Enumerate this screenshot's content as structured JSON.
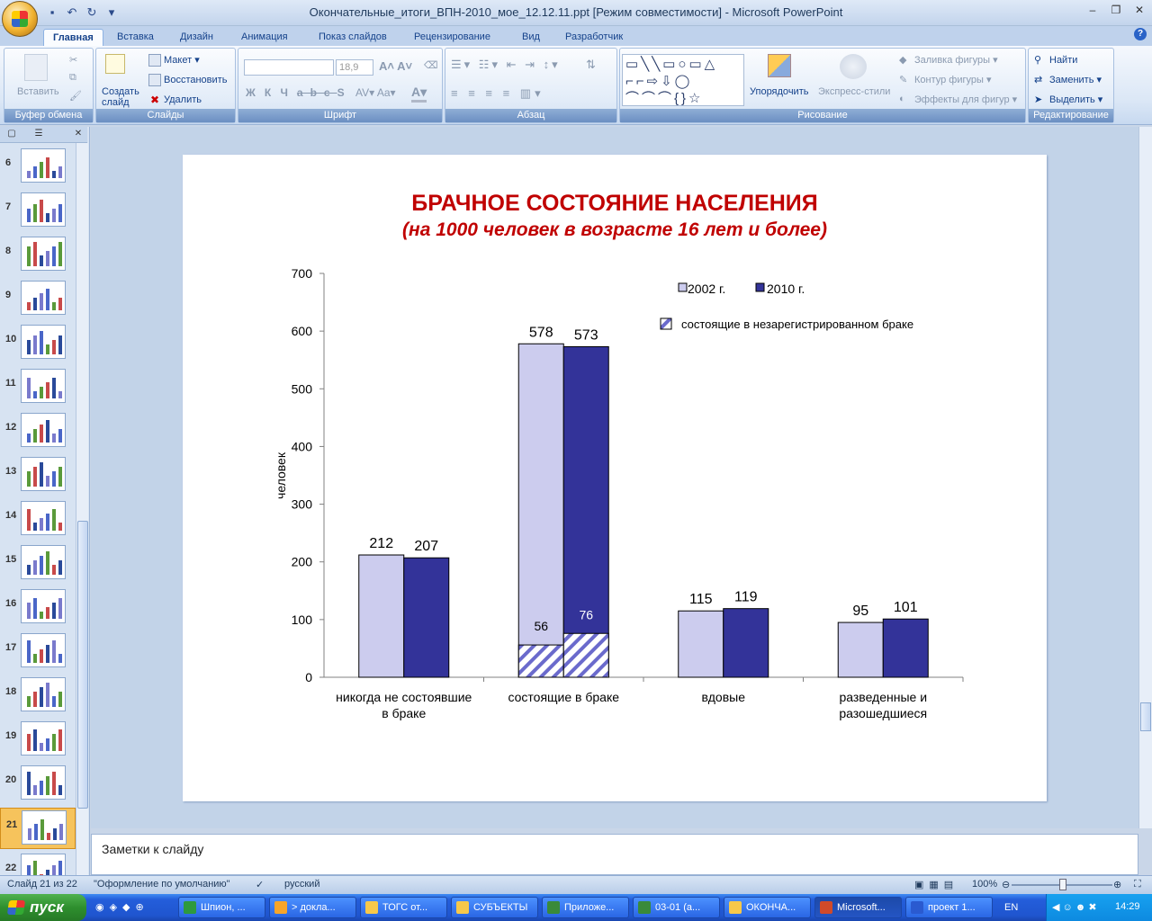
{
  "window": {
    "title": "Окончательные_итоги_ВПН-2010_мое_12.12.11.ppt [Режим совместимости] - Microsoft PowerPoint"
  },
  "ribbon": {
    "tabs": [
      "Главная",
      "Вставка",
      "Дизайн",
      "Анимация",
      "Показ слайдов",
      "Рецензирование",
      "Вид",
      "Разработчик"
    ],
    "active_tab": "Главная",
    "groups": {
      "clipboard": {
        "label": "Буфер обмена",
        "paste": "Вставить"
      },
      "slides": {
        "label": "Слайды",
        "create": "Создать слайд",
        "layout": "Макет",
        "reset": "Восстановить",
        "delete": "Удалить"
      },
      "font": {
        "label": "Шрифт",
        "font_size": "18,9"
      },
      "paragraph": {
        "label": "Абзац"
      },
      "drawing": {
        "label": "Рисование",
        "arrange": "Упорядочить",
        "quick_styles": "Экспресс-стили",
        "fill": "Заливка фигуры",
        "outline": "Контур фигуры",
        "effects": "Эффекты для фигур"
      },
      "editing": {
        "label": "Редактирование",
        "find": "Найти",
        "replace": "Заменить",
        "select": "Выделить"
      }
    }
  },
  "slide_panel": {
    "numbers": [
      "6",
      "7",
      "8",
      "9",
      "10",
      "11",
      "12",
      "13",
      "14",
      "15",
      "16",
      "17",
      "18",
      "19",
      "20",
      "21",
      "22"
    ],
    "selected": "21"
  },
  "notes": {
    "placeholder": "Заметки к слайду"
  },
  "status": {
    "slide_info": "Слайд 21 из 22",
    "theme": "\"Оформление по умолчанию\"",
    "language": "русский",
    "zoom": "100%"
  },
  "taskbar": {
    "start": "пуск",
    "tasks": [
      "Шпион, ...",
      "> доклa...",
      "ТОГС от...",
      "СУБЪЕКТЫ",
      "Приложе...",
      "03-01 (а...",
      "ОКОНЧА...",
      "Microsoft...",
      "проект 1..."
    ],
    "active_task": "Microsoft...",
    "lang": "EN",
    "time": "14:29"
  },
  "colors": {
    "series_2002": "#ccccee",
    "series_2010": "#333399",
    "title_red": "#c00000"
  },
  "chart_data": {
    "type": "bar",
    "title": "БРАЧНОЕ СОСТОЯНИЕ НАСЕЛЕНИЯ",
    "subtitle": "(на 1000 человек в возрасте 16 лет и более)",
    "ylabel": "человек",
    "ylim": [
      0,
      700
    ],
    "yticks": [
      "0",
      "100",
      "200",
      "300",
      "400",
      "500",
      "600",
      "700"
    ],
    "categories": [
      "никогда не состоявшие в браке",
      "состоящие  в браке",
      "вдовые",
      "разведенные  и разошедшиеся"
    ],
    "series": [
      {
        "name": "2002 г.",
        "values": [
          212,
          578,
          115,
          95
        ]
      },
      {
        "name": "2010 г.",
        "values": [
          207,
          573,
          119,
          101
        ]
      }
    ],
    "sub_series": {
      "name": "состоящие в незарегистрированном браке",
      "category": "состоящие  в браке",
      "values": [
        56,
        76
      ]
    },
    "legend_position": "top-right"
  }
}
